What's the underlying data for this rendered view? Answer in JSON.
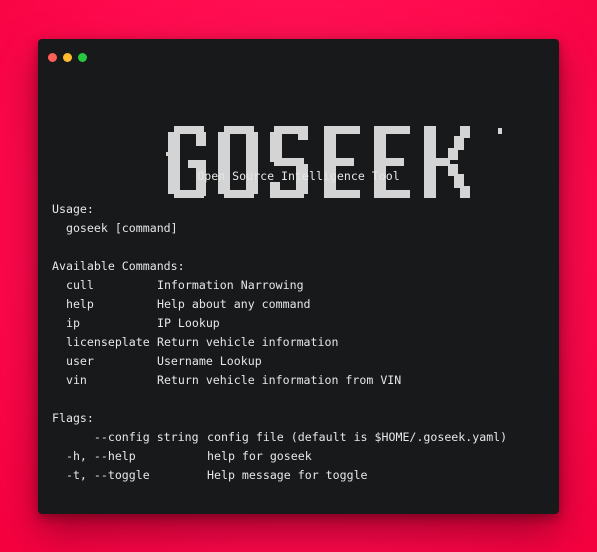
{
  "window": {
    "dots": [
      {
        "name": "close",
        "color": "#ff5f57"
      },
      {
        "name": "minimize",
        "color": "#febc2e"
      },
      {
        "name": "maximize",
        "color": "#28c840"
      }
    ]
  },
  "logo": {
    "text": "GOSEEK",
    "color": "#d4d4d4"
  },
  "tagline": "Open Source Intelligence Tool",
  "usage": {
    "heading": "Usage:",
    "line": "  goseek [command]"
  },
  "commands": {
    "heading": "Available Commands:",
    "items": [
      {
        "name": "cull",
        "desc": "Information Narrowing"
      },
      {
        "name": "help",
        "desc": "Help about any command"
      },
      {
        "name": "ip",
        "desc": "IP Lookup"
      },
      {
        "name": "licenseplate",
        "desc": "Return vehicle information"
      },
      {
        "name": "user",
        "desc": "Username Lookup"
      },
      {
        "name": "vin",
        "desc": "Return vehicle information from VIN"
      }
    ]
  },
  "flags": {
    "heading": "Flags:",
    "items": [
      {
        "flag": "      --config string",
        "desc": "config file (default is $HOME/.goseek.yaml)"
      },
      {
        "flag": "  -h, --help",
        "desc": "help for goseek"
      },
      {
        "flag": "  -t, --toggle",
        "desc": "Help message for toggle"
      }
    ]
  }
}
